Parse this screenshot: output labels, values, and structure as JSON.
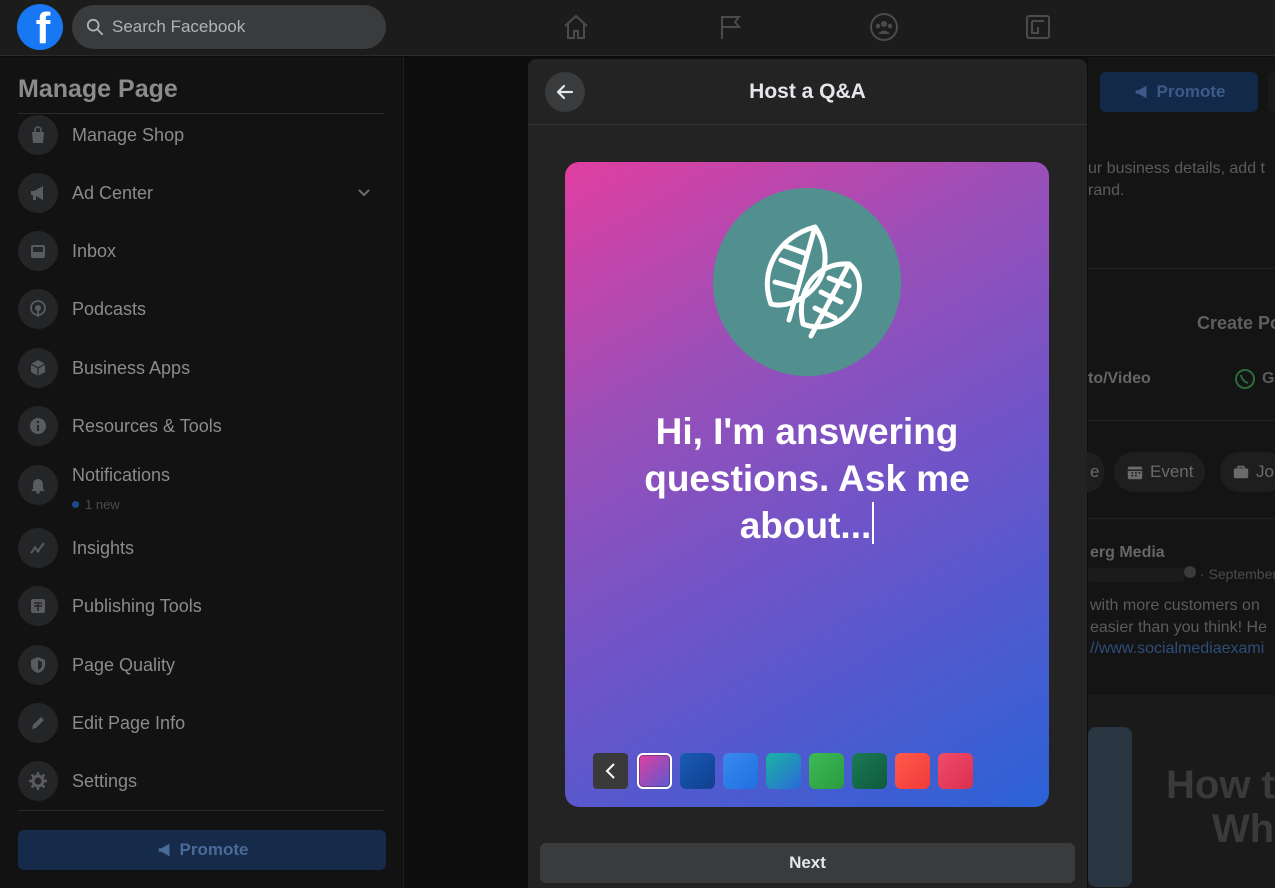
{
  "topbar": {
    "logo_letter": "f",
    "search_placeholder": "Search Facebook",
    "nav_icons": [
      "home-icon",
      "flag-icon",
      "groups-icon",
      "gaming-icon"
    ]
  },
  "sidebar": {
    "title": "Manage Page",
    "items": [
      {
        "label": "Manage Shop",
        "icon": "shop-bag-icon"
      },
      {
        "label": "Ad Center",
        "icon": "megaphone-icon"
      },
      {
        "label": "Inbox",
        "icon": "inbox-icon"
      },
      {
        "label": "Podcasts",
        "icon": "podcast-icon"
      },
      {
        "label": "Business Apps",
        "icon": "cube-icon"
      },
      {
        "label": "Resources & Tools",
        "icon": "info-icon"
      },
      {
        "label": "Notifications",
        "icon": "bell-icon",
        "sub": "1 new"
      },
      {
        "label": "Insights",
        "icon": "insights-icon"
      },
      {
        "label": "Publishing Tools",
        "icon": "publishing-icon"
      },
      {
        "label": "Page Quality",
        "icon": "shield-icon"
      },
      {
        "label": "Edit Page Info",
        "icon": "pencil-icon"
      },
      {
        "label": "Settings",
        "icon": "gear-icon"
      }
    ],
    "promote_label": "Promote"
  },
  "background": {
    "promote_label": "Promote",
    "desc_line1": "ur business details, add t",
    "desc_line2": "rand.",
    "create_post": "Create Po",
    "photo_video": "to/Video",
    "whatsapp_label": "G",
    "event_label": "Event",
    "partial_pill_1": "e",
    "jobs_label": "Jo",
    "author": "erg Media",
    "date": "· September",
    "post_line1": "with more customers on",
    "post_line2": "easier than you think! He",
    "post_link": "//www.socialmediaexami",
    "thumb_line1": "How t",
    "thumb_line2": "Wh"
  },
  "modal": {
    "title": "Host a Q&A",
    "card_text": "Hi, I'm answering questions. Ask me about...",
    "next_label": "Next",
    "swatches": [
      {
        "name": "pink-purple-gradient",
        "colors": [
          "#e13ea0",
          "#5a5ad0"
        ],
        "selected": true
      },
      {
        "name": "dark-blue",
        "colors": [
          "#1b5bb5",
          "#0e3f8e"
        ]
      },
      {
        "name": "blue",
        "colors": [
          "#3a8af0",
          "#1f6fe0"
        ]
      },
      {
        "name": "teal-gradient",
        "colors": [
          "#1bb3a2",
          "#2a6ad8"
        ]
      },
      {
        "name": "green",
        "colors": [
          "#3dbb55",
          "#2a9c40"
        ]
      },
      {
        "name": "dark-green",
        "colors": [
          "#1b7a55",
          "#0e5a3c"
        ]
      },
      {
        "name": "red-orange",
        "colors": [
          "#ff5a4a",
          "#f03a3a"
        ]
      },
      {
        "name": "red-pink",
        "colors": [
          "#f24a6a",
          "#d8304e"
        ]
      }
    ]
  }
}
